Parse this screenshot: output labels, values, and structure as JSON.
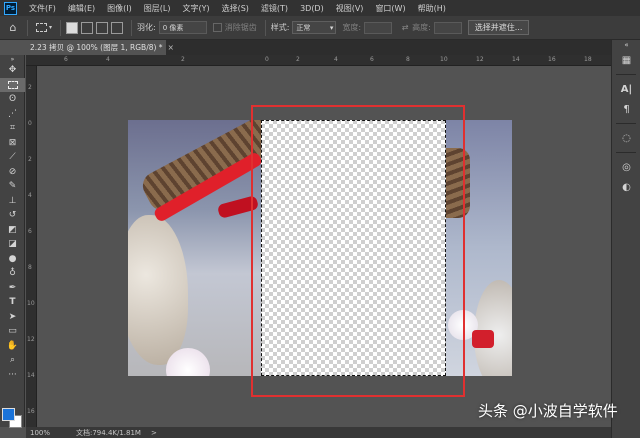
{
  "app": {
    "logo": "Ps"
  },
  "menu": [
    "文件(F)",
    "编辑(E)",
    "图像(I)",
    "图层(L)",
    "文字(Y)",
    "选择(S)",
    "滤镜(T)",
    "3D(D)",
    "视图(V)",
    "窗口(W)",
    "帮助(H)"
  ],
  "options": {
    "feather_label": "羽化:",
    "feather_value": "0 像素",
    "antialias_label": "消除锯齿",
    "style_label": "样式:",
    "style_value": "正常",
    "width_label": "宽度:",
    "height_label": "高度:",
    "select_mask_button": "选择并遮住..."
  },
  "document": {
    "tab_title": "2.23 拷贝 @ 100% (图层 1, RGB/8) *",
    "close_glyph": "×"
  },
  "ruler_top": [
    "6",
    "4",
    "2",
    "0",
    "2",
    "4",
    "6",
    "8",
    "10",
    "12",
    "14",
    "16",
    "18"
  ],
  "ruler_left": [
    "2",
    "0",
    "2",
    "4",
    "6",
    "8",
    "10",
    "12",
    "14",
    "16"
  ],
  "status": {
    "zoom": "100%",
    "doc_info": "文档:794.4K/1.81M",
    "arrow": ">"
  },
  "watermark": "头条 @小波自学软件",
  "colors": {
    "foreground": "#1a73d9",
    "background": "#ffffff",
    "highlight_box": "#e03030"
  }
}
